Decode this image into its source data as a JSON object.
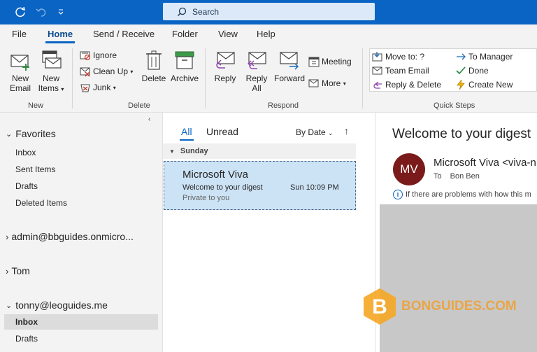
{
  "titlebar": {
    "search_label": "Search",
    "icons": [
      "sync-icon",
      "undo-icon",
      "customize-qat-icon"
    ]
  },
  "menu": {
    "tabs": [
      "File",
      "Home",
      "Send / Receive",
      "Folder",
      "View",
      "Help"
    ],
    "active": "Home"
  },
  "ribbon": {
    "new_group": {
      "label": "New",
      "new_email": [
        "New",
        "Email"
      ],
      "new_items": [
        "New",
        "Items"
      ]
    },
    "delete_group": {
      "label": "Delete",
      "ignore": "Ignore",
      "cleanup": "Clean Up",
      "junk": "Junk",
      "delete": "Delete",
      "archive": "Archive"
    },
    "respond_group": {
      "label": "Respond",
      "reply": "Reply",
      "reply_all": [
        "Reply",
        "All"
      ],
      "forward": "Forward",
      "meeting": "Meeting",
      "more": "More"
    },
    "quicksteps_group": {
      "label": "Quick Steps",
      "items": [
        "Move to: ?",
        "Team Email",
        "Reply & Delete",
        "To Manager",
        "Done",
        "Create New"
      ]
    }
  },
  "nav": {
    "favorites_label": "Favorites",
    "favorites": [
      "Inbox",
      "Sent Items",
      "Drafts",
      "Deleted Items"
    ],
    "accounts": [
      "admin@bbguides.onmicro...",
      "Tom",
      "tonny@leoguides.me"
    ],
    "tonny_folders": [
      "Inbox",
      "Drafts"
    ]
  },
  "list": {
    "tab_all": "All",
    "tab_unread": "Unread",
    "sort": "By Date",
    "group": "Sunday",
    "message": {
      "from": "Microsoft Viva",
      "subject": "Welcome to your digest",
      "date": "Sun 10:09 PM",
      "preview": "Private to you"
    }
  },
  "reading": {
    "subject": "Welcome to your digest",
    "avatar_initials": "MV",
    "from": "Microsoft Viva <viva-n",
    "to_label": "To",
    "to": "Bon Ben",
    "info": "If there are problems with how this m"
  },
  "watermark": {
    "letter": "B",
    "text": "BONGUIDES.COM"
  },
  "colors": {
    "accent": "#0a64c4",
    "selected": "#cce3f5",
    "avatar": "#7a1a1a"
  }
}
